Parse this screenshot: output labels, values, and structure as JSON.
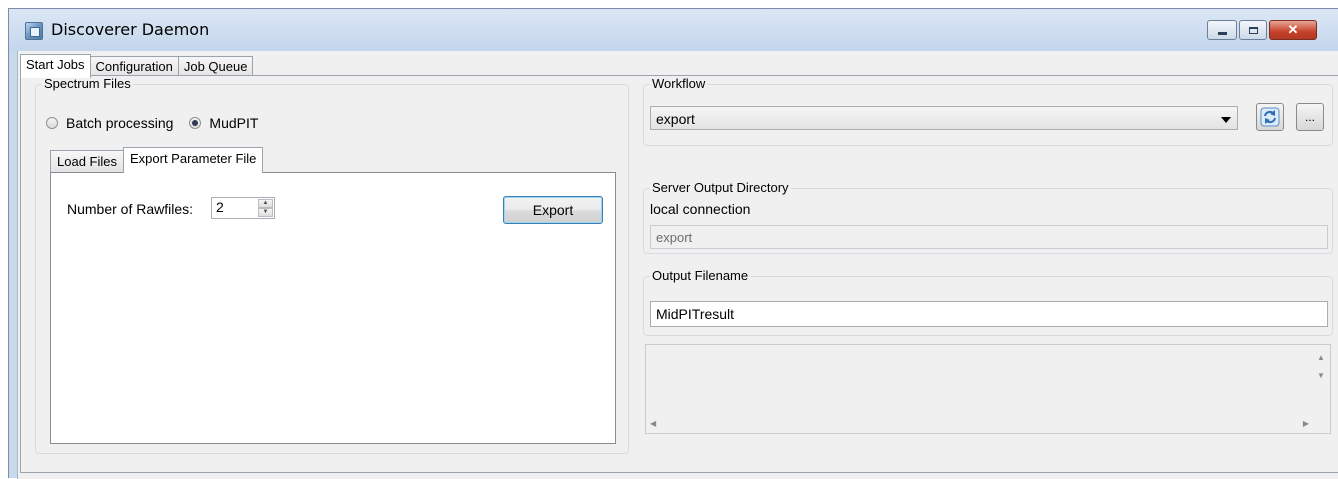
{
  "window": {
    "title": "Discoverer Daemon",
    "close_glyph": "✕"
  },
  "main_tabs": [
    {
      "label": "Start Jobs",
      "active": true
    },
    {
      "label": "Configuration",
      "active": false
    },
    {
      "label": "Job Queue",
      "active": false
    }
  ],
  "spectrum_files": {
    "group_label": "Spectrum Files",
    "radio_batch_label": "Batch processing",
    "radio_mudpit_label": "MudPIT",
    "selected": "MudPIT",
    "inner_tabs": [
      {
        "label": "Load Files",
        "active": false
      },
      {
        "label": "Export Parameter File",
        "active": true
      }
    ],
    "rawfiles_label": "Number of Rawfiles:",
    "rawfiles_value": "2",
    "export_button": "Export"
  },
  "workflow": {
    "group_label": "Workflow",
    "selected": "export",
    "refresh_icon": "refresh-icon",
    "browse_button": "..."
  },
  "server_output": {
    "group_label": "Server Output Directory",
    "connection_text": "local connection",
    "directory_value": "export"
  },
  "output_filename": {
    "group_label": "Output Filename",
    "value": "MidPITresult"
  },
  "scroll_glyphs": {
    "up": "▲",
    "down": "▼",
    "left": "◀",
    "right": "▶"
  },
  "colors": {
    "title_bar": "#c4d6ec",
    "close_button": "#c6412b",
    "panel_background": "#f0f0f0"
  }
}
